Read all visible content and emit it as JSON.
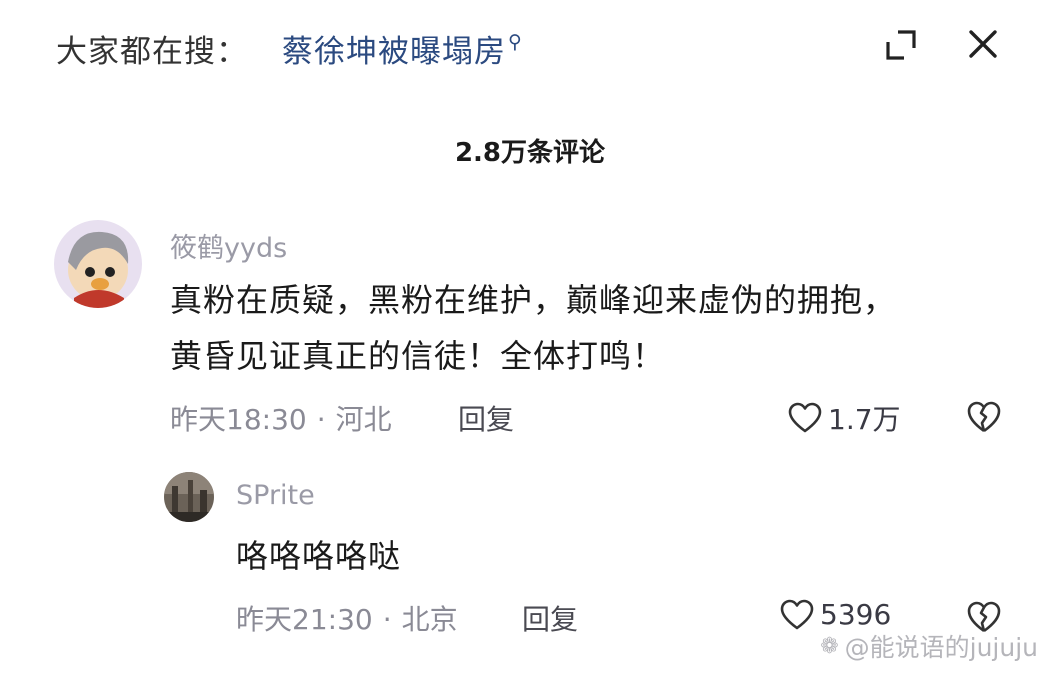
{
  "header": {
    "search_prefix": "大家都在搜：",
    "search_query": "蔡徐坤被曝塌房"
  },
  "comment_count": "2.8万条评论",
  "comments": [
    {
      "username": "筱鹤yyds",
      "text_line1": "真粉在质疑，黑粉在维护，巅峰迎来虚伪的拥抱，",
      "text_line2": "黄昏见证真正的信徒！全体打鸣！",
      "time": "昨天18:30",
      "location": "河北",
      "reply_label": "回复",
      "likes": "1.7万"
    },
    {
      "username": "SPrite",
      "text_line1": "咯咯咯咯哒",
      "time": "昨天21:30",
      "location": "北京",
      "reply_label": "回复",
      "likes": "5396"
    }
  ],
  "watermark": "@能说语的jujuju",
  "icons": {
    "search": "search-icon",
    "expand": "expand-icon",
    "close": "close-icon",
    "like": "heart-icon",
    "dislike": "broken-heart-icon"
  },
  "colors": {
    "query": "#2b4a80",
    "meta": "#8a8a95",
    "username": "#9a9aa6"
  }
}
